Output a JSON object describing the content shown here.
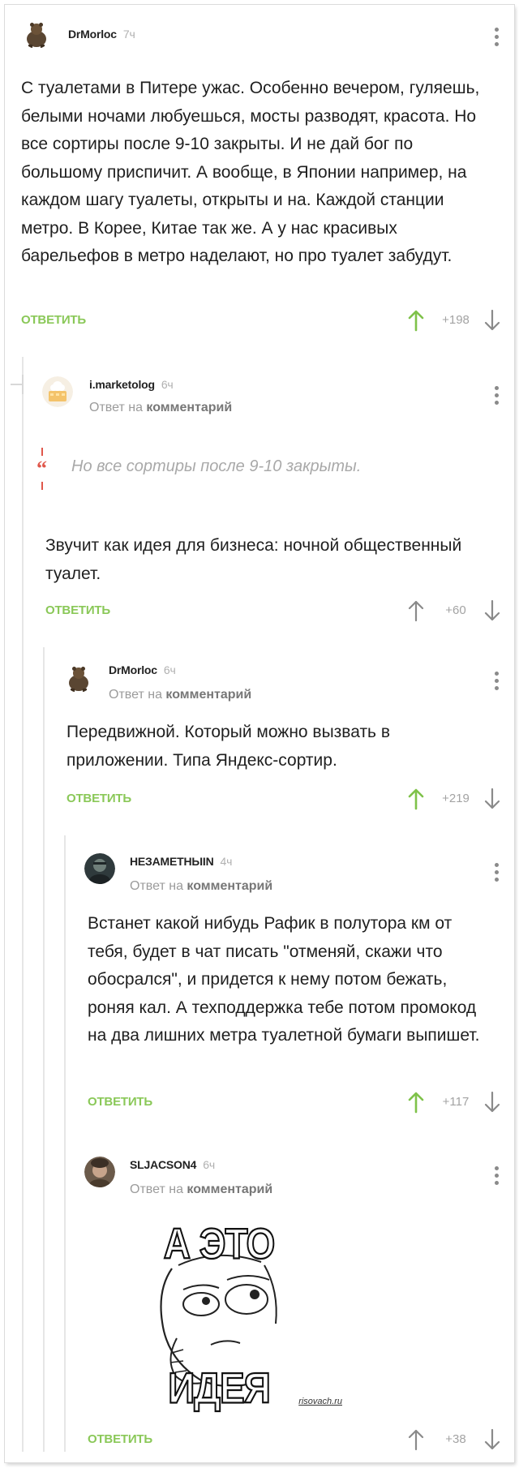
{
  "comments": [
    {
      "username": "DrMorloc",
      "time": "7ч",
      "text": "С туалетами в Питере ужас. Особенно вечером, гуляешь, белыми ночами любуешься, мосты разводят, красота. Но все сортиры после 9-10 закрыты. И не дай бог по большому приспичит. А вообще, в Японии например, на каждом шагу туалеты, открыты и на. Каждой станции метро. В Корее, Китае так же. А у нас красивых барельефов в метро наделают, но про туалет забудут.",
      "reply_label": "ОТВЕТИТЬ",
      "rating": "+198"
    },
    {
      "username": "i.marketolog",
      "time": "6ч",
      "reply_prefix": "Ответ на",
      "reply_target": "комментарий",
      "quote": "Но все сортиры после 9-10 закрыты.",
      "text": "Звучит как идея для бизнеса: ночной общественный туалет.",
      "reply_label": "ОТВЕТИТЬ",
      "rating": "+60"
    },
    {
      "username": "DrMorloc",
      "time": "6ч",
      "reply_prefix": "Ответ на",
      "reply_target": "комментарий",
      "text": "Передвижной. Который можно вызвать в приложении. Типа Яндекс-сортир.",
      "reply_label": "ОТВЕТИТЬ",
      "rating": "+219"
    },
    {
      "username": "НЕЗАМЕТНЫIN",
      "time": "4ч",
      "reply_prefix": "Ответ на",
      "reply_target": "комментарий",
      "text": "Встанет какой нибудь Рафик в полутора км от тебя, будет в чат писать \"отменяй, скажи что обосрался\", и придется к нему потом бежать, роняя кал. А техподдержка тебе потом промокод на два лишних метра туалетной бумаги выпишет.",
      "reply_label": "ОТВЕТИТЬ",
      "rating": "+117"
    },
    {
      "username": "SLJACSON4",
      "time": "6ч",
      "reply_prefix": "Ответ на",
      "reply_target": "комментарий",
      "meme_top": "А ЭТО",
      "meme_bottom": "ИДЕЯ",
      "meme_watermark": "risovach.ru",
      "reply_label": "ОТВЕТИТЬ",
      "rating": "+38"
    }
  ],
  "colors": {
    "accent_green": "#8ac858",
    "upvoted_green": "#7fc24a",
    "quote_red": "#e0574b",
    "muted_gray": "#9b9b9b"
  }
}
